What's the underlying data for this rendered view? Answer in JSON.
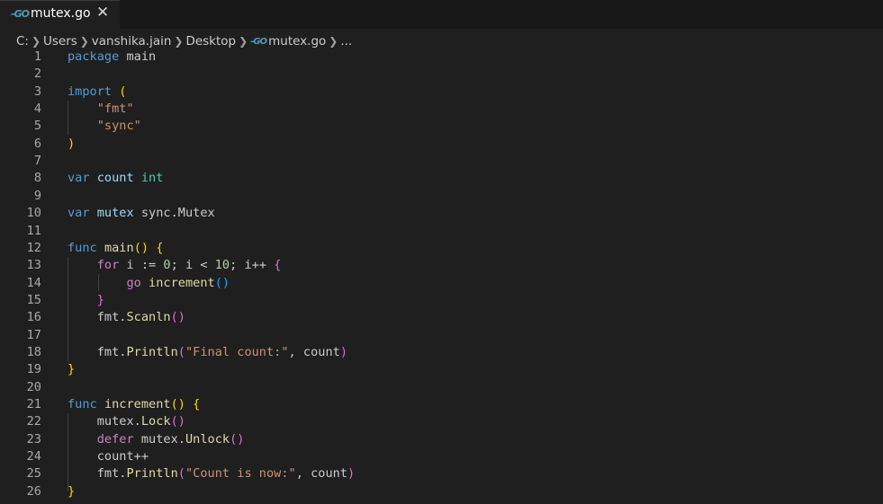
{
  "tab": {
    "filename": "mutex.go",
    "close": "✕",
    "file_icon": "go-file-icon"
  },
  "breadcrumb": {
    "items": [
      "C:",
      "Users",
      "vanshika.jain",
      "Desktop",
      "mutex.go",
      "..."
    ],
    "separator": ">"
  },
  "lines": [
    {
      "n": "1",
      "t": [
        {
          "c": "kw",
          "v": "package"
        },
        {
          "c": "",
          "v": " main"
        }
      ]
    },
    {
      "n": "2",
      "t": []
    },
    {
      "n": "3",
      "t": [
        {
          "c": "kw",
          "v": "import"
        },
        {
          "c": "",
          "v": " "
        },
        {
          "c": "b1",
          "v": "("
        }
      ]
    },
    {
      "n": "4",
      "t": [
        {
          "c": "",
          "v": "    "
        },
        {
          "c": "str",
          "v": "\"fmt\""
        }
      ]
    },
    {
      "n": "5",
      "t": [
        {
          "c": "",
          "v": "    "
        },
        {
          "c": "str",
          "v": "\"sync\""
        }
      ]
    },
    {
      "n": "6",
      "t": [
        {
          "c": "b1",
          "v": ")"
        }
      ]
    },
    {
      "n": "7",
      "t": []
    },
    {
      "n": "8",
      "t": [
        {
          "c": "kw",
          "v": "var"
        },
        {
          "c": "",
          "v": " "
        },
        {
          "c": "id",
          "v": "count"
        },
        {
          "c": "",
          "v": " "
        },
        {
          "c": "ty",
          "v": "int"
        }
      ]
    },
    {
      "n": "9",
      "t": []
    },
    {
      "n": "10",
      "t": [
        {
          "c": "kw",
          "v": "var"
        },
        {
          "c": "",
          "v": " "
        },
        {
          "c": "id",
          "v": "mutex"
        },
        {
          "c": "",
          "v": " sync.Mutex"
        }
      ]
    },
    {
      "n": "11",
      "t": []
    },
    {
      "n": "12",
      "t": [
        {
          "c": "kw",
          "v": "func"
        },
        {
          "c": "",
          "v": " "
        },
        {
          "c": "fn",
          "v": "main"
        },
        {
          "c": "b1",
          "v": "()"
        },
        {
          "c": "",
          "v": " "
        },
        {
          "c": "b1",
          "v": "{"
        }
      ]
    },
    {
      "n": "13",
      "t": [
        {
          "c": "",
          "v": "    "
        },
        {
          "c": "kw2",
          "v": "for"
        },
        {
          "c": "",
          "v": " i := "
        },
        {
          "c": "num",
          "v": "0"
        },
        {
          "c": "",
          "v": "; i < "
        },
        {
          "c": "num",
          "v": "10"
        },
        {
          "c": "",
          "v": "; i++ "
        },
        {
          "c": "b2",
          "v": "{"
        }
      ]
    },
    {
      "n": "14",
      "t": [
        {
          "c": "",
          "v": "        "
        },
        {
          "c": "kw2",
          "v": "go"
        },
        {
          "c": "",
          "v": " "
        },
        {
          "c": "fn",
          "v": "increment"
        },
        {
          "c": "b3",
          "v": "()"
        }
      ]
    },
    {
      "n": "15",
      "t": [
        {
          "c": "",
          "v": "    "
        },
        {
          "c": "b2",
          "v": "}"
        }
      ]
    },
    {
      "n": "16",
      "t": [
        {
          "c": "",
          "v": "    fmt."
        },
        {
          "c": "fn",
          "v": "Scanln"
        },
        {
          "c": "b2",
          "v": "()"
        }
      ]
    },
    {
      "n": "17",
      "t": []
    },
    {
      "n": "18",
      "t": [
        {
          "c": "",
          "v": "    fmt."
        },
        {
          "c": "fn",
          "v": "Println"
        },
        {
          "c": "b2",
          "v": "("
        },
        {
          "c": "str",
          "v": "\"Final count:\""
        },
        {
          "c": "",
          "v": ", count"
        },
        {
          "c": "b2",
          "v": ")"
        }
      ]
    },
    {
      "n": "19",
      "t": [
        {
          "c": "b1",
          "v": "}"
        }
      ]
    },
    {
      "n": "20",
      "t": []
    },
    {
      "n": "21",
      "t": [
        {
          "c": "kw",
          "v": "func"
        },
        {
          "c": "",
          "v": " "
        },
        {
          "c": "fn",
          "v": "increment"
        },
        {
          "c": "b1",
          "v": "()"
        },
        {
          "c": "",
          "v": " "
        },
        {
          "c": "b1",
          "v": "{"
        }
      ]
    },
    {
      "n": "22",
      "t": [
        {
          "c": "",
          "v": "    mutex."
        },
        {
          "c": "fn",
          "v": "Lock"
        },
        {
          "c": "b2",
          "v": "()"
        }
      ]
    },
    {
      "n": "23",
      "t": [
        {
          "c": "",
          "v": "    "
        },
        {
          "c": "kw2",
          "v": "defer"
        },
        {
          "c": "",
          "v": " mutex."
        },
        {
          "c": "fn",
          "v": "Unlock"
        },
        {
          "c": "b2",
          "v": "()"
        }
      ]
    },
    {
      "n": "24",
      "t": [
        {
          "c": "",
          "v": "    count++"
        }
      ]
    },
    {
      "n": "25",
      "t": [
        {
          "c": "",
          "v": "    fmt."
        },
        {
          "c": "fn",
          "v": "Println"
        },
        {
          "c": "b2",
          "v": "("
        },
        {
          "c": "str",
          "v": "\"Count is now:\""
        },
        {
          "c": "",
          "v": ", count"
        },
        {
          "c": "b2",
          "v": ")"
        }
      ]
    },
    {
      "n": "26",
      "t": [
        {
          "c": "b1",
          "v": "}"
        }
      ]
    }
  ]
}
